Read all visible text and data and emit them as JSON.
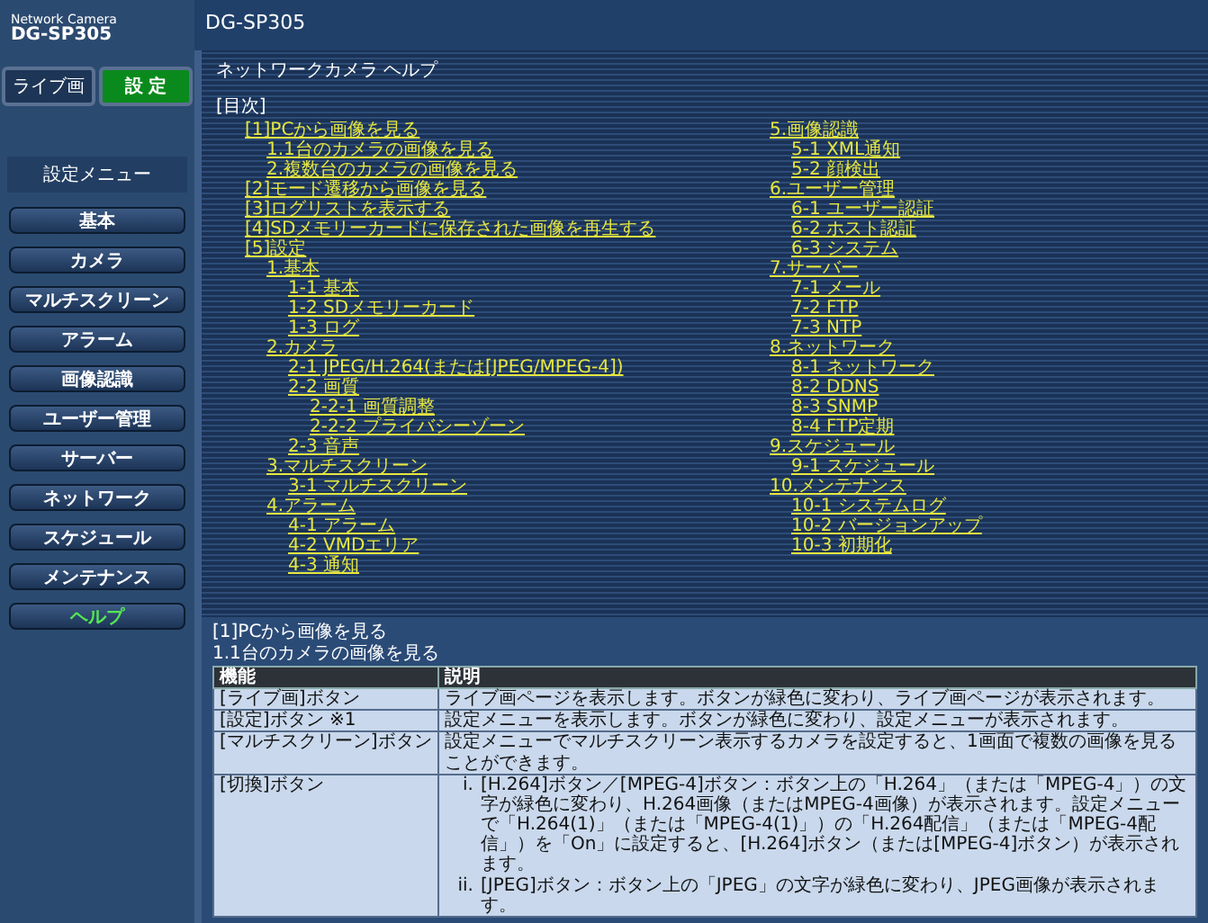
{
  "logo": {
    "line_1": "Network Camera",
    "line_2": "DG-SP305"
  },
  "mode_buttons": [
    {
      "label": "ライブ画",
      "selected": false
    },
    {
      "label": "設 定",
      "selected": true
    }
  ],
  "menu": {
    "title": "設定メニュー",
    "items": [
      {
        "label": "基本",
        "selected": false
      },
      {
        "label": "カメラ",
        "selected": false
      },
      {
        "label": "マルチスクリーン",
        "selected": false
      },
      {
        "label": "アラーム",
        "selected": false
      },
      {
        "label": "画像認識",
        "selected": false
      },
      {
        "label": "ユーザー管理",
        "selected": false
      },
      {
        "label": "サーバー",
        "selected": false
      },
      {
        "label": "ネットワーク",
        "selected": false
      },
      {
        "label": "スケジュール",
        "selected": false
      },
      {
        "label": "メンテナンス",
        "selected": false
      },
      {
        "label": "ヘルプ",
        "selected": true
      }
    ]
  },
  "header": {
    "title": "DG-SP305"
  },
  "help": {
    "title": "ネットワークカメラ ヘルプ",
    "toc_heading": "[目次]",
    "toc": [
      {
        "text": "[1]PCから画像を見る",
        "children": [
          {
            "text": "1.1台のカメラの画像を見る"
          },
          {
            "text": "2.複数台のカメラの画像を見る"
          }
        ]
      },
      {
        "text": "[2]モード遷移から画像を見る"
      },
      {
        "text": "[3]ログリストを表示する"
      },
      {
        "text": "[4]SDメモリーカードに保存された画像を再生する"
      },
      {
        "text": "[5]設定",
        "children": [
          {
            "text": "1.基本",
            "children": [
              {
                "text": "1-1 基本"
              },
              {
                "text": "1-2 SDメモリーカード"
              },
              {
                "text": "1-3 ログ"
              }
            ]
          },
          {
            "text": "2.カメラ",
            "children": [
              {
                "text": "2-1 JPEG/H.264(または[JPEG/MPEG-4])"
              },
              {
                "text": "2-2 画質",
                "children": [
                  {
                    "text": "2-2-1 画質調整"
                  },
                  {
                    "text": "2-2-2 プライバシーゾーン"
                  }
                ]
              },
              {
                "text": "2-3 音声"
              }
            ]
          },
          {
            "text": "3.マルチスクリーン",
            "children": [
              {
                "text": "3-1 マルチスクリーン"
              }
            ]
          },
          {
            "text": "4.アラーム",
            "children": [
              {
                "text": "4-1 アラーム"
              },
              {
                "text": "4-2 VMDエリア"
              },
              {
                "text": "4-3 通知"
              }
            ]
          },
          {
            "text": "5.画像認識",
            "children": [
              {
                "text": "5-1 XML通知"
              },
              {
                "text": "5-2 顔検出"
              }
            ]
          },
          {
            "text": "6.ユーザー管理",
            "children": [
              {
                "text": "6-1 ユーザー認証"
              },
              {
                "text": "6-2 ホスト認証"
              },
              {
                "text": "6-3 システム"
              }
            ]
          },
          {
            "text": "7.サーバー",
            "children": [
              {
                "text": "7-1 メール"
              },
              {
                "text": "7-2 FTP"
              },
              {
                "text": "7-3 NTP"
              }
            ]
          },
          {
            "text": "8.ネットワーク",
            "children": [
              {
                "text": "8-1 ネットワーク"
              },
              {
                "text": "8-2 DDNS"
              },
              {
                "text": "8-3 SNMP"
              },
              {
                "text": "8-4 FTP定期"
              }
            ]
          },
          {
            "text": "9.スケジュール",
            "children": [
              {
                "text": "9-1 スケジュール"
              }
            ]
          },
          {
            "text": "10.メンテナンス",
            "children": [
              {
                "text": "10-1 システムログ"
              },
              {
                "text": "10-2 バージョンアップ"
              },
              {
                "text": "10-3 初期化"
              }
            ]
          }
        ]
      }
    ]
  },
  "detail": {
    "heading_1": "[1]PCから画像を見る",
    "heading_2": "1.1台のカメラの画像を見る",
    "columns": [
      "機能",
      "説明"
    ],
    "rows": [
      {
        "function": "[ライブ画]ボタン",
        "description": "ライブ画ページを表示します。ボタンが緑色に変わり、ライブ画ページが表示されます。"
      },
      {
        "function": "[設定]ボタン ※1",
        "description": "設定メニューを表示します。ボタンが緑色に変わり、設定メニューが表示されます。"
      },
      {
        "function": "[マルチスクリーン]ボタン",
        "description": "設定メニューでマルチスクリーン表示するカメラを設定すると、1画面で複数の画像を見ることができます。"
      },
      {
        "function": "[切換]ボタン",
        "list": [
          {
            "marker": "i.",
            "text": "[H.264]ボタン／[MPEG-4]ボタン：ボタン上の「H.264」（または「MPEG-4」）の文字が緑色に変わり、H.264画像（またはMPEG-4画像）が表示されます。設定メニューで「H.264(1)」（または「MPEG-4(1)」）の「H.264配信」（または「MPEG-4配信」）を「On」に設定すると、[H.264]ボタン（または[MPEG-4]ボタン）が表示されます。"
          },
          {
            "marker": "ii.",
            "text": "[JPEG]ボタン：ボタン上の「JPEG」の文字が緑色に変わり、JPEG画像が表示されます。"
          }
        ]
      }
    ]
  }
}
